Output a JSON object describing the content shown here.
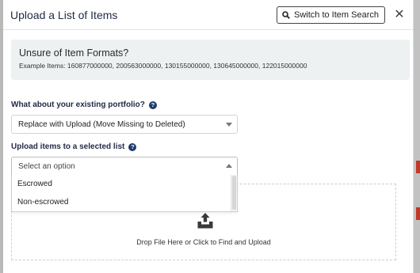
{
  "modal": {
    "title": "Upload a List of Items",
    "switch_button_label": "Switch to Item Search",
    "close_glyph": "✕"
  },
  "info": {
    "title": "Unsure of Item Formats?",
    "examples": "Example Items: 160877000000, 200563000000, 130155000000, 130645000000, 122015000000"
  },
  "portfolio": {
    "label": "What about your existing portfolio?",
    "selected": "Replace with Upload (Move Missing to Deleted)"
  },
  "list_select": {
    "label": "Upload items to a selected list",
    "placeholder": "Select an option",
    "options": [
      "Escrowed",
      "Non-escrowed"
    ]
  },
  "dropzone": {
    "text": "Drop File Here or Click to Find and Upload"
  },
  "help_glyph": "?",
  "icons": {
    "search": "search-icon",
    "close": "close-icon",
    "help": "help-icon",
    "upload": "upload-tray-icon",
    "caret": "chevron-down-icon"
  },
  "colors": {
    "title": "#1f2a44",
    "help_badge": "#1f3a6a",
    "info_bg": "#eef1f1",
    "edge_mark": "#c0392b"
  }
}
